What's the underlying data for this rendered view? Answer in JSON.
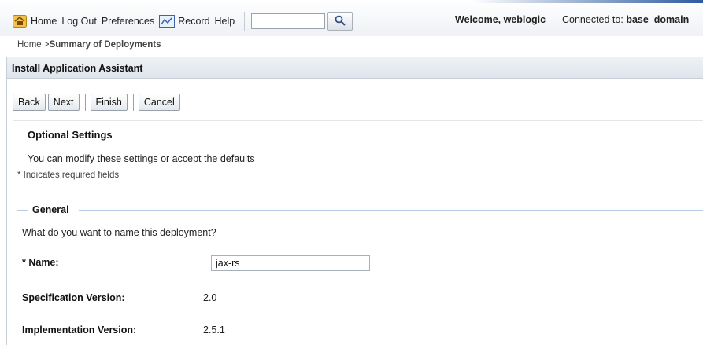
{
  "toolbar": {
    "home": "Home",
    "logout": "Log Out",
    "preferences": "Preferences",
    "record": "Record",
    "help": "Help",
    "search_value": "",
    "icons": [
      "home-icon",
      "record-icon",
      "search-icon"
    ]
  },
  "session": {
    "welcome_prefix": "Welcome, ",
    "user": "weblogic",
    "connected_prefix": "Connected to: ",
    "domain": "base_domain"
  },
  "breadcrumb": {
    "home": "Home",
    "separator": " >",
    "current": "Summary of Deployments"
  },
  "panel": {
    "title": "Install Application Assistant"
  },
  "buttons": {
    "back": "Back",
    "next": "Next",
    "finish": "Finish",
    "cancel": "Cancel"
  },
  "optional": {
    "title": "Optional Settings",
    "description": "You can modify these settings or accept the defaults",
    "required_note": "* Indicates required fields"
  },
  "general": {
    "title": "General",
    "question": "What do you want to name this deployment?",
    "name_label": "* Name:",
    "name_value": "jax-rs",
    "spec_label": "Specification Version:",
    "spec_value": "2.0",
    "impl_label": "Implementation Version:",
    "impl_value": "2.5.1"
  },
  "colors": {
    "section_line": "#b8cbe4",
    "header_bg": "#dfe5ec",
    "accent": "#2c5aa0"
  }
}
